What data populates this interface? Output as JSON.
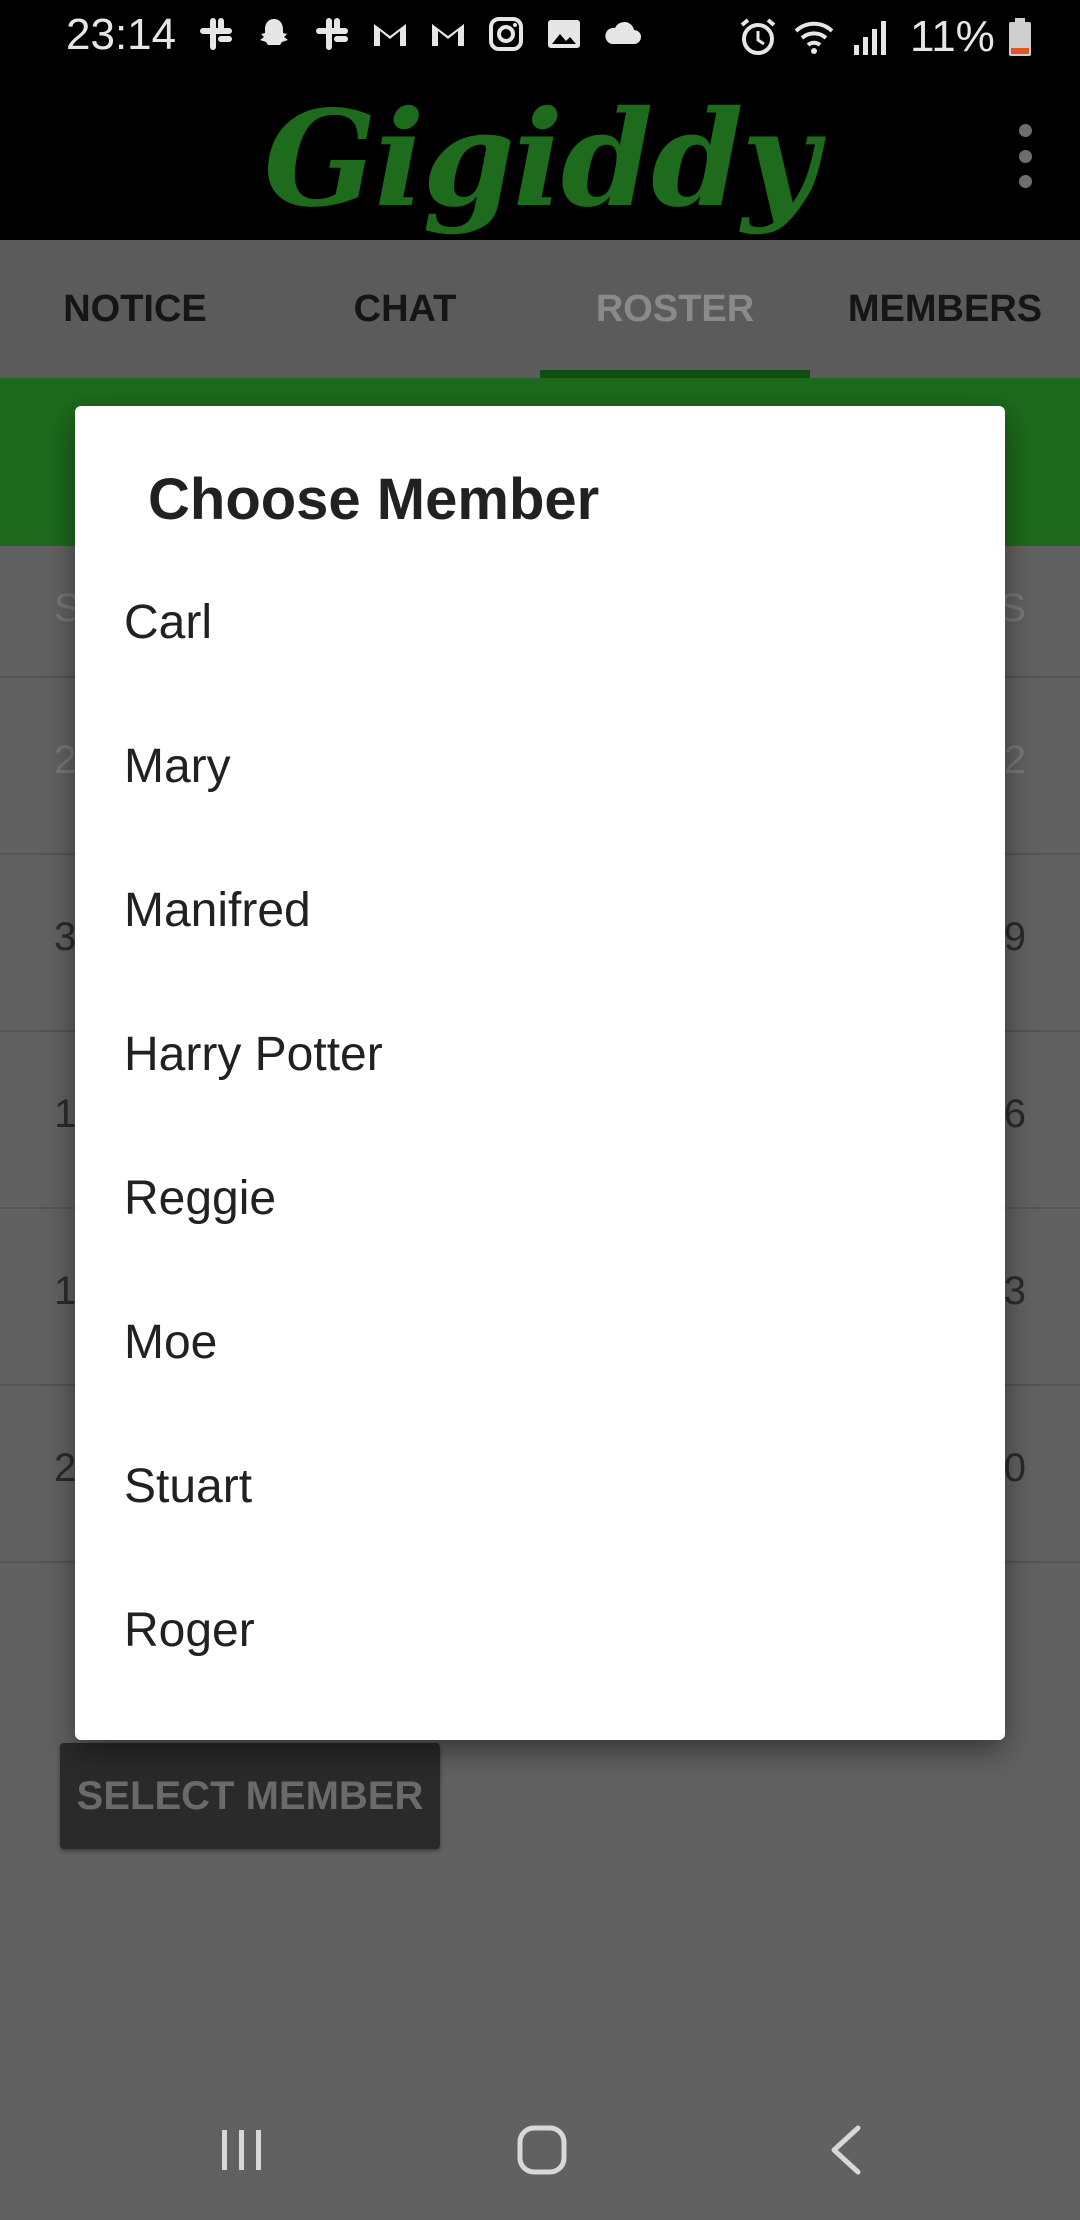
{
  "status_bar": {
    "time": "23:14",
    "battery_percent": "11%",
    "notification_icons": [
      "slack-icon",
      "snapchat-icon",
      "slack-icon",
      "gmail-icon",
      "gmail-icon",
      "instagram-icon",
      "gallery-icon",
      "cloud-icon"
    ],
    "system_icons": [
      "alarm-icon",
      "wifi-icon",
      "signal-icon",
      "battery-icon"
    ]
  },
  "app_bar": {
    "title": "Gigiddy",
    "title_color": "#1e6b1e"
  },
  "tabs": [
    {
      "label": "NOTICE",
      "active": false
    },
    {
      "label": "CHAT",
      "active": false
    },
    {
      "label": "ROSTER",
      "active": true
    },
    {
      "label": "MEMBERS",
      "active": false
    }
  ],
  "background_roster": {
    "header": {
      "left": "S",
      "right": "S"
    },
    "rows": [
      {
        "left": "2",
        "right": "2"
      },
      {
        "left": "3",
        "right": "9"
      },
      {
        "left": "1",
        "right": "6"
      },
      {
        "left": "1",
        "right": "3"
      },
      {
        "left": "2",
        "right": "0"
      }
    ],
    "select_button_label": "SELECT MEMBER"
  },
  "dialog": {
    "title": "Choose Member",
    "members": [
      "Carl",
      "Mary",
      "Manifred",
      "Harry Potter",
      "Reggie",
      "Moe",
      "Stuart",
      "Roger"
    ]
  },
  "nav_bar": {
    "buttons": [
      "recents-icon",
      "home-icon",
      "back-icon"
    ]
  },
  "colors": {
    "accent_green": "#1d6a1d",
    "scrim": "#616161",
    "dialog_bg": "#ffffff"
  }
}
